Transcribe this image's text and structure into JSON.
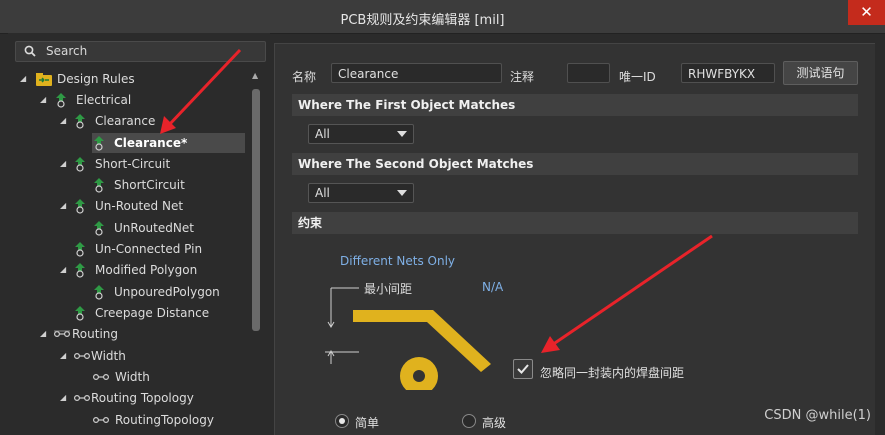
{
  "window": {
    "title": "PCB规则及约束编辑器 [mil]",
    "close_glyph": "✕"
  },
  "search": {
    "placeholder": "Search"
  },
  "tree": [
    {
      "label": "Design Rules"
    },
    {
      "label": "Electrical"
    },
    {
      "label": "Clearance"
    },
    {
      "label": "Clearance*"
    },
    {
      "label": "Short-Circuit"
    },
    {
      "label": "ShortCircuit"
    },
    {
      "label": "Un-Routed Net"
    },
    {
      "label": "UnRoutedNet"
    },
    {
      "label": "Un-Connected Pin"
    },
    {
      "label": "Modified Polygon"
    },
    {
      "label": "UnpouredPolygon"
    },
    {
      "label": "Creepage Distance"
    },
    {
      "label": "Routing"
    },
    {
      "label": "Width"
    },
    {
      "label": "Width"
    },
    {
      "label": "Routing Topology"
    },
    {
      "label": "RoutingTopology"
    }
  ],
  "rule": {
    "name_label": "名称",
    "name_value": "Clearance",
    "comment_label": "注释",
    "comment_value": "",
    "uid_label": "唯一ID",
    "uid_value": "RHWFBYKX",
    "test_button": "测试语句"
  },
  "first_match": {
    "header": "Where The First Object Matches",
    "selected": "All"
  },
  "second_match": {
    "header": "Where The Second Object Matches",
    "selected": "All"
  },
  "constraints": {
    "header": "约束",
    "nets_text": "Different Nets Only",
    "min_clearance_label": "最小间距",
    "min_clearance_value": "N/A",
    "ignore_pad_label": "忽略同一封装内的焊盘间距",
    "mode_simple": "简单",
    "mode_advanced": "高级"
  },
  "watermark": "CSDN @while(1)",
  "colors": {
    "accent_copper": "#e0b21e",
    "link_blue": "#7fb0e6",
    "annotation_red": "#e8232a"
  }
}
